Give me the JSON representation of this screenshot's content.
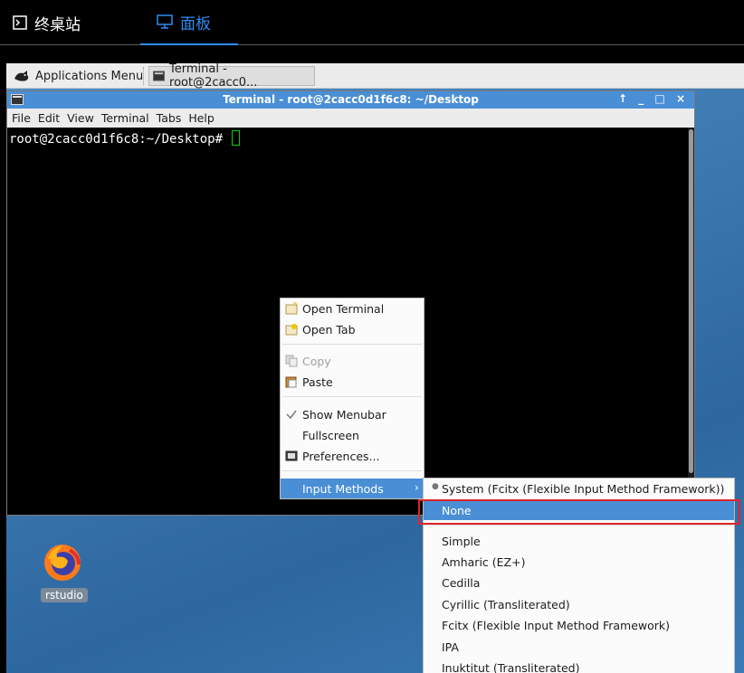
{
  "topbar": {
    "tab_terminal": "终桌站",
    "tab_panel": "面板"
  },
  "panel": {
    "apps_menu": "Applications Menu",
    "task_terminal": "Terminal - root@2cacc0..."
  },
  "window": {
    "title": "Terminal - root@2cacc0d1f6c8: ~/Desktop",
    "controls": "↑ _ □ ×",
    "menus": [
      "File",
      "Edit",
      "View",
      "Terminal",
      "Tabs",
      "Help"
    ],
    "prompt": "root@2cacc0d1f6c8:~/Desktop# "
  },
  "desktop_icon": {
    "label": "rstudio"
  },
  "context_menu": {
    "open_terminal": "Open Terminal",
    "open_tab": "Open Tab",
    "copy": "Copy",
    "paste": "Paste",
    "show_menubar": "Show Menubar",
    "fullscreen": "Fullscreen",
    "preferences": "Preferences...",
    "input_methods": "Input Methods"
  },
  "input_methods_submenu": {
    "items": [
      "System (Fcitx (Flexible Input Method Framework))",
      "None",
      "Simple",
      "Amharic (EZ+)",
      "Cedilla",
      "Cyrillic (Transliterated)",
      "Fcitx (Flexible Input Method Framework)",
      "IPA",
      "Inuktitut (Transliterated)"
    ]
  },
  "colors": {
    "accent": "#4a8fd6",
    "topbar_active": "#2f8cf4",
    "highlight_box": "#e0242a"
  }
}
